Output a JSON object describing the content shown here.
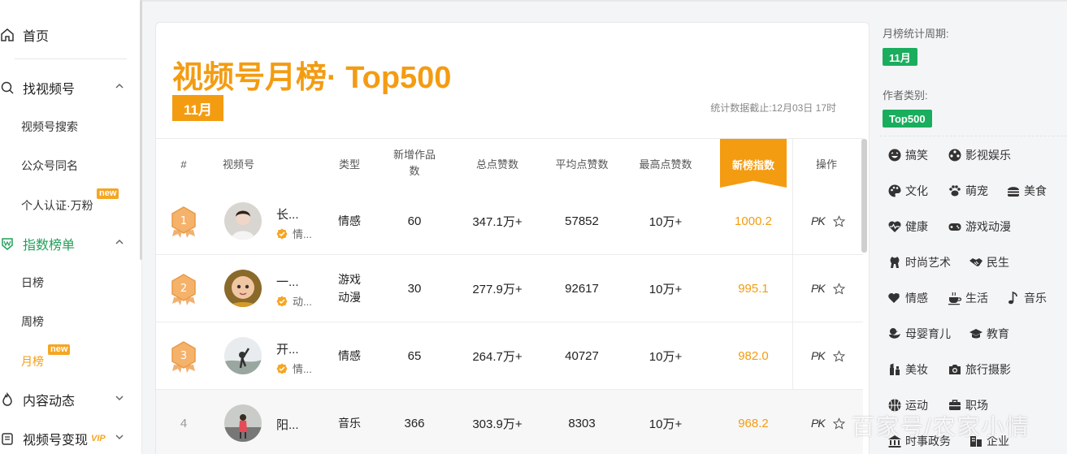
{
  "sidebar": {
    "home": "首页",
    "find": "找视频号",
    "find_sub": [
      "视频号搜索",
      "公众号同名",
      "个人认证·万粉"
    ],
    "rank": "指数榜单",
    "rank_sub": [
      "日榜",
      "周榜",
      "月榜"
    ],
    "new_badge": "new",
    "content": "内容动态",
    "monetize": "视频号变现",
    "vip": "VIP"
  },
  "main": {
    "title": "视频号月榜· Top500",
    "month": "11月",
    "stat_note": "统计数据截止:12月03日 17时",
    "headers": {
      "rank": "#",
      "channel": "视频号",
      "type": "类型",
      "new_works": "新增作品数",
      "total_likes": "总点赞数",
      "avg_likes": "平均点赞数",
      "max_likes": "最高点赞数",
      "index": "新榜指数",
      "ops": "操作"
    },
    "rows": [
      {
        "rank": "1",
        "name": "长...",
        "cat": "情...",
        "type": "情感",
        "new_works": "60",
        "total_likes": "347.1万+",
        "avg_likes": "57852",
        "max_likes": "10万+",
        "index": "1000.2",
        "pk": "PK"
      },
      {
        "rank": "2",
        "name": "一...",
        "cat": "动...",
        "type": "游戏动漫",
        "new_works": "30",
        "total_likes": "277.9万+",
        "avg_likes": "92617",
        "max_likes": "10万+",
        "index": "995.1",
        "pk": "PK"
      },
      {
        "rank": "3",
        "name": "开...",
        "cat": "情...",
        "type": "情感",
        "new_works": "65",
        "total_likes": "264.7万+",
        "avg_likes": "40727",
        "max_likes": "10万+",
        "index": "982.0",
        "pk": "PK"
      },
      {
        "rank": "4",
        "name": "阳...",
        "cat": "",
        "type": "音乐",
        "new_works": "366",
        "total_likes": "303.9万+",
        "avg_likes": "8303",
        "max_likes": "10万+",
        "index": "968.2",
        "pk": "PK"
      }
    ]
  },
  "right": {
    "period_label": "月榜统计周期:",
    "period_value": "11月",
    "author_label": "作者类别:",
    "author_value": "Top500",
    "categories": [
      "搞笑",
      "影视娱乐",
      "文化",
      "萌宠",
      "美食",
      "健康",
      "游戏动漫",
      "时尚艺术",
      "民生",
      "情感",
      "生活",
      "音乐",
      "母婴育儿",
      "教育",
      "美妆",
      "旅行摄影",
      "运动",
      "职场",
      "时事政务",
      "企业"
    ]
  },
  "watermark": "百家号/农家小情",
  "colors": {
    "accent": "#f39c12",
    "green": "#1aad5e",
    "active_green": "#22a05a"
  }
}
